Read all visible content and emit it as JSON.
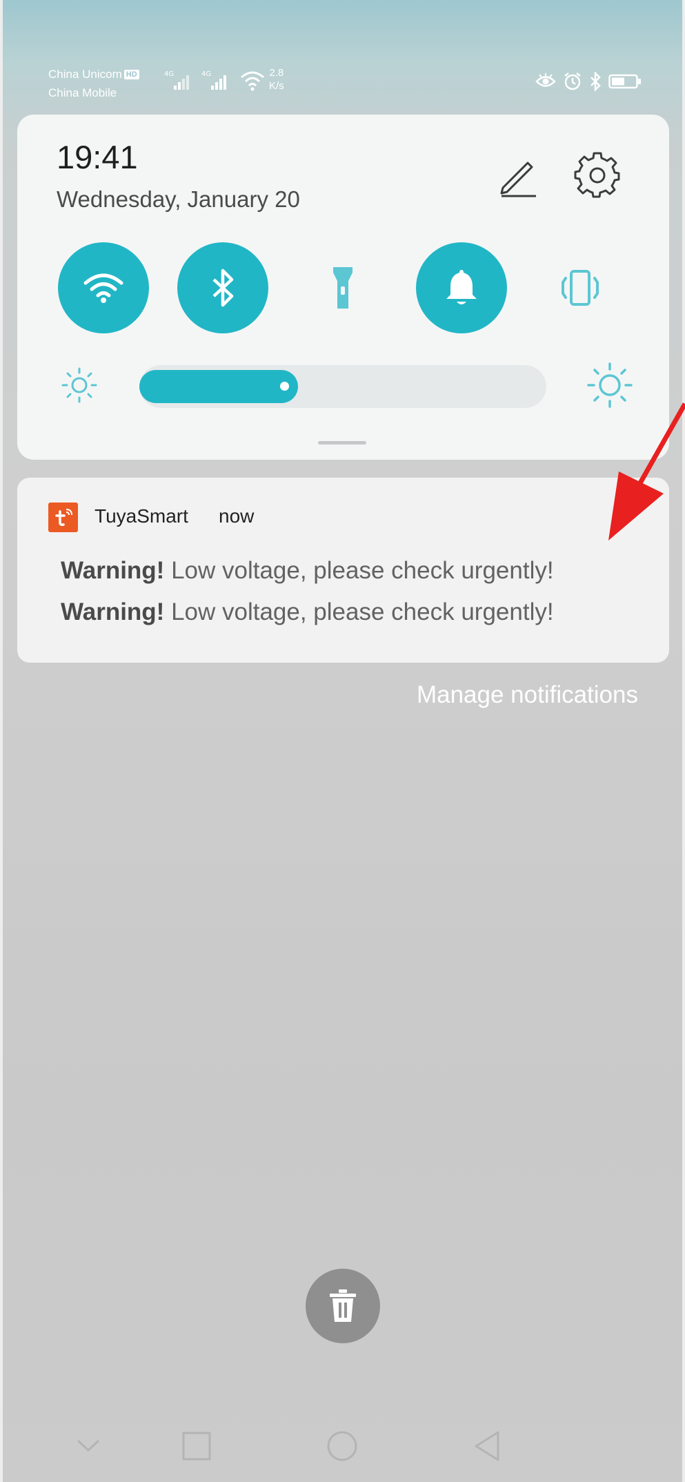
{
  "status_bar": {
    "carrier_1": "China Unicom",
    "carrier_2": "China Mobile",
    "hd_badge": "HD",
    "network_1": "4G",
    "network_2": "4G",
    "speed_value": "2.8",
    "speed_unit": "K/s",
    "icons": [
      "eye-icon",
      "alarm-icon",
      "bluetooth-icon",
      "battery-icon"
    ]
  },
  "quick_settings": {
    "time": "19:41",
    "date": "Wednesday, January 20",
    "tiles": [
      {
        "name": "wifi",
        "state": "on"
      },
      {
        "name": "bluetooth",
        "state": "on"
      },
      {
        "name": "flashlight",
        "state": "off"
      },
      {
        "name": "sound",
        "state": "on"
      },
      {
        "name": "vibrate",
        "state": "off"
      }
    ],
    "brightness": 0.39
  },
  "notification": {
    "app_name": "TuyaSmart",
    "time": "now",
    "messages": [
      {
        "bold": "Warning!",
        "text": " Low voltage, please check urgently!"
      },
      {
        "bold": "Warning!",
        "text": " Low voltage, please check urgently!"
      }
    ]
  },
  "manage_notifications": "Manage notifications",
  "colors": {
    "accent": "#21b6c6",
    "app_icon": "#ec5a24",
    "annotation_arrow": "#e8201f"
  }
}
